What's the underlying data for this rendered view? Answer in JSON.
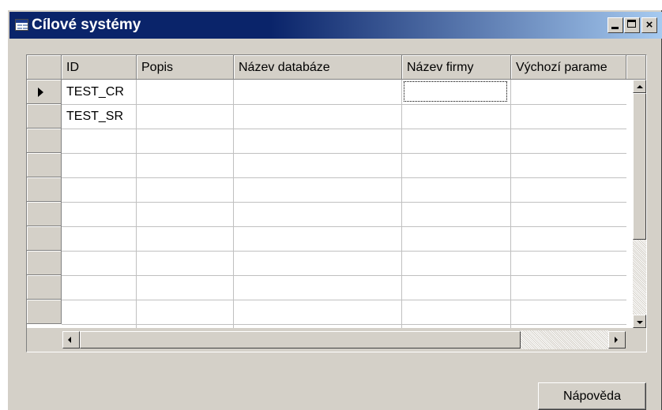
{
  "window": {
    "title": "Cílové systémy",
    "icon": "table-icon",
    "caption_buttons": [
      "minimize-icon",
      "maximize-icon",
      "close-icon"
    ],
    "close_glyph": "×"
  },
  "grid": {
    "columns": [
      "ID",
      "Popis",
      "Název databáze",
      "Název firmy",
      "Výchozí parame"
    ],
    "rows": [
      {
        "id": "TEST_CR",
        "popis": "",
        "nazev_databaze": "",
        "nazev_firmy": "",
        "vychozi": "",
        "current": true
      },
      {
        "id": "TEST_SR",
        "popis": "",
        "nazev_databaze": "",
        "nazev_firmy": "",
        "vychozi": "",
        "current": false
      }
    ],
    "empty_rows": 8
  },
  "buttons": {
    "help_label": "Nápověda"
  }
}
